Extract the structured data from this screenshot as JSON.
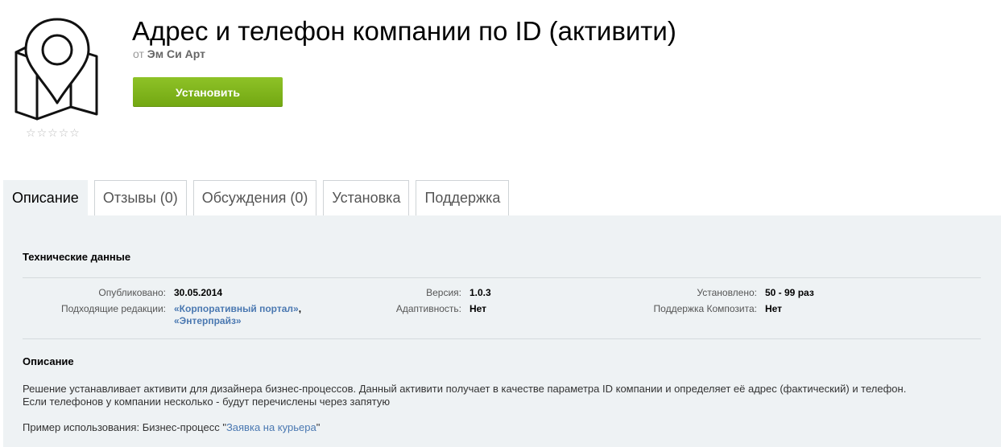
{
  "header": {
    "title": "Адрес и телефон компании по ID (активити)",
    "author_prefix": "от",
    "author_name": "Эм Си Арт",
    "install_label": "Установить",
    "app_icon": "map-pin-icon",
    "rating_stars": 0,
    "stars": [
      "☆",
      "☆",
      "☆",
      "☆",
      "☆"
    ]
  },
  "tabs": [
    {
      "label": "Описание",
      "active": true
    },
    {
      "label": "Отзывы (0)",
      "active": false
    },
    {
      "label": "Обсуждения (0)",
      "active": false
    },
    {
      "label": "Установка",
      "active": false
    },
    {
      "label": "Поддержка",
      "active": false
    }
  ],
  "tech": {
    "title": "Технические данные",
    "published_label": "Опубликовано:",
    "published_value": "30.05.2014",
    "editions_label": "Подходящие редакции:",
    "edition_1": "«Корпоративный портал»",
    "edition_sep": ",",
    "edition_2": "«Энтерпрайз»",
    "version_label": "Версия:",
    "version_value": "1.0.3",
    "adaptive_label": "Адаптивность:",
    "adaptive_value": "Нет",
    "installed_label": "Установлено:",
    "installed_value": "50 - 99 раз",
    "composite_label": "Поддержка Композита:",
    "composite_value": "Нет"
  },
  "description": {
    "title": "Описание",
    "line1": "Решение устанавливает активити для дизайнера бизнес-процессов. Данный активити получает в качестве параметра ID компании и определяет её адрес (фактический) и телефон.",
    "line2": "Если телефонов у компании несколько - будут перечислены через запятую",
    "example_prefix": "Пример использования: Бизнес-процесс \"",
    "example_link": "Заявка на курьера",
    "example_suffix": "\""
  },
  "colors": {
    "accent_green": "#7ab51d",
    "link_blue": "#4a78b1",
    "panel_bg": "#eef2f4"
  }
}
